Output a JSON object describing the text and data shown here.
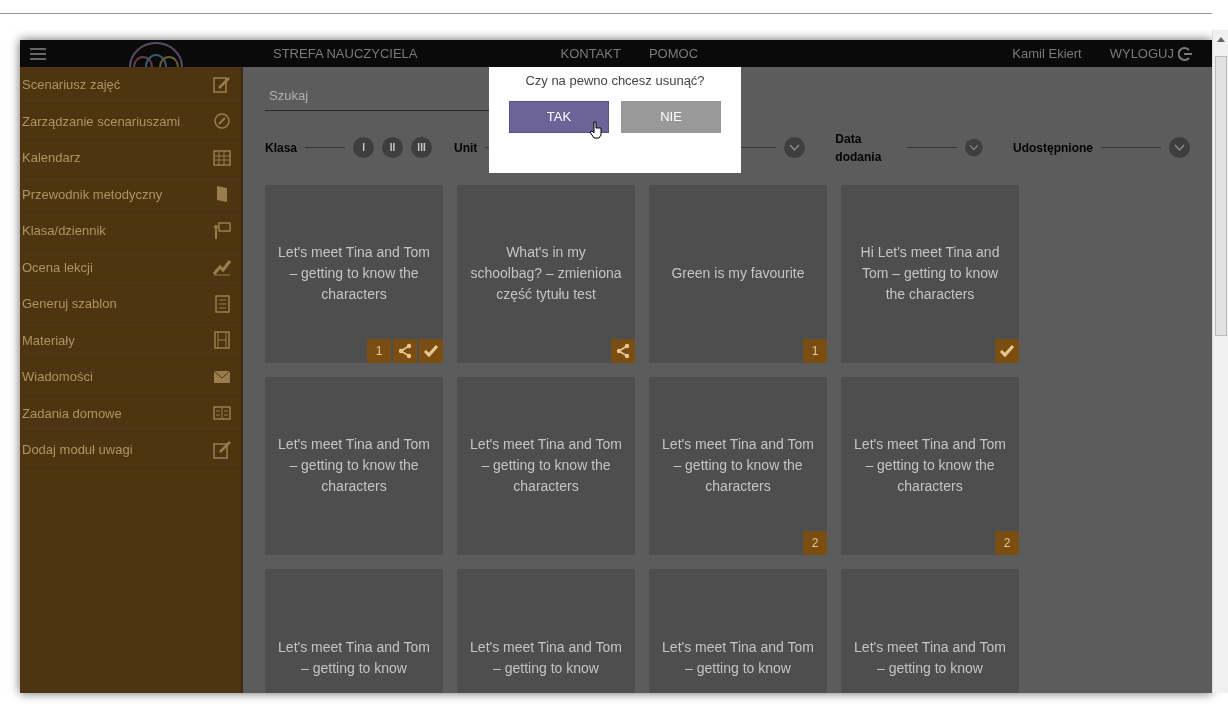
{
  "header": {
    "title": "STREFA NAUCZYCIELA",
    "links": [
      "KONTAKT",
      "POMOC"
    ],
    "user": "Kamil Ekiert",
    "logout": "WYLOGUJ"
  },
  "sidebar": {
    "items": [
      {
        "label": "Scenariusz zajęć"
      },
      {
        "label": "Zarządzanie scenariuszami"
      },
      {
        "label": "Kalendarz"
      },
      {
        "label": "Przewodnik metodyczny"
      },
      {
        "label": "Klasa/dziennik"
      },
      {
        "label": "Ocena lekcji"
      },
      {
        "label": "Generuj szablon"
      },
      {
        "label": "Materiały"
      },
      {
        "label": "Wiadomości"
      },
      {
        "label": "Zadania domowe"
      },
      {
        "label": "Dodaj moduł uwagi"
      }
    ]
  },
  "search": {
    "placeholder": "Szukaj"
  },
  "filters": [
    {
      "kind": "levels",
      "label": "Klasa",
      "options": [
        "I",
        "II",
        "III"
      ]
    },
    {
      "kind": "dropdown",
      "label": "Unit"
    },
    {
      "kind": "dropdown"
    },
    {
      "kind": "dropdown",
      "label": "Data dodania"
    },
    {
      "kind": "dropdown",
      "label": "Udostępnione"
    }
  ],
  "cards": [
    {
      "title": "Let's meet Tina and Tom – getting to know the characters",
      "count": "1",
      "shared": true,
      "approved": true
    },
    {
      "title": "What's in my schoolbag? – zmieniona część tytułu test",
      "shared": true,
      "approved": false
    },
    {
      "title": "Green is my favourite",
      "count": "1",
      "shared": false,
      "approved": false
    },
    {
      "title": "Hi Let's meet Tina and Tom – getting to know the characters",
      "shared": false,
      "approved": true
    },
    {
      "title": "Let's meet Tina and Tom – getting to know the characters",
      "shared": false,
      "approved": false
    },
    {
      "title": "Let's meet Tina and Tom – getting to know the characters",
      "shared": false,
      "approved": false
    },
    {
      "title": "Let's meet Tina and Tom – getting to know the characters",
      "count": "2",
      "shared": false,
      "approved": false
    },
    {
      "title": "Let's meet Tina and Tom – getting to know the characters",
      "count": "2",
      "shared": false,
      "approved": false
    },
    {
      "title": "Let's meet Tina and Tom – getting to know",
      "shared": false,
      "approved": false
    },
    {
      "title": "Let's meet Tina and Tom – getting to know",
      "shared": false,
      "approved": false
    },
    {
      "title": "Let's meet Tina and Tom – getting to know",
      "shared": false,
      "approved": false
    },
    {
      "title": "Let's meet Tina and Tom – getting to know",
      "shared": false,
      "approved": false
    }
  ],
  "dialog": {
    "question": "Czy na pewno chcesz usunąć?",
    "buttons": [
      {
        "label": "TAK",
        "kind": "confirm",
        "hovered": true
      },
      {
        "label": "NIE",
        "kind": "cancel",
        "hovered": false
      }
    ]
  }
}
